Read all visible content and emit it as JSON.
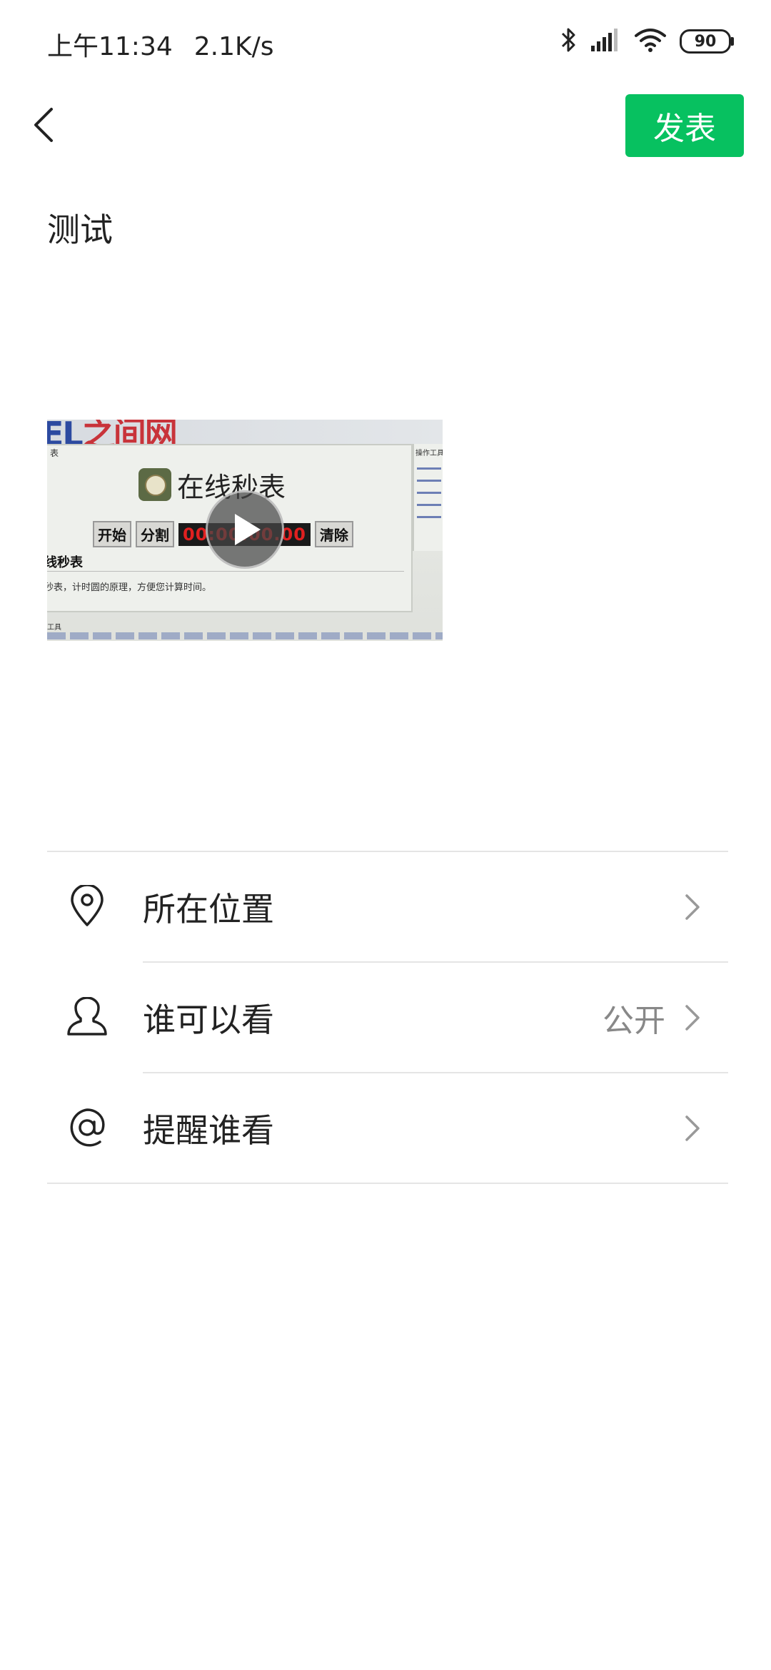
{
  "status_bar": {
    "time": "上午11:34",
    "speed": "2.1K/s",
    "battery": "90"
  },
  "header": {
    "publish_label": "发表"
  },
  "post": {
    "text": "测试"
  },
  "video": {
    "header_text_blue": "EL",
    "header_text_red": "之间网",
    "panel_label": "表",
    "side_title": "操作工具",
    "title": "在线秒表",
    "btn_start": "开始",
    "btn_split": "分割",
    "timer": "00:00:00.00",
    "btn_clear": "清除",
    "section_title": "线秒表",
    "description": "秒表，计时圆的原理，方便您计算时间。",
    "footer_label": "工具"
  },
  "settings": {
    "items": [
      {
        "label": "所在位置",
        "value": "",
        "icon": "location-pin-icon"
      },
      {
        "label": "谁可以看",
        "value": "公开",
        "icon": "person-icon"
      },
      {
        "label": "提醒谁看",
        "value": "",
        "icon": "at-icon"
      }
    ]
  }
}
